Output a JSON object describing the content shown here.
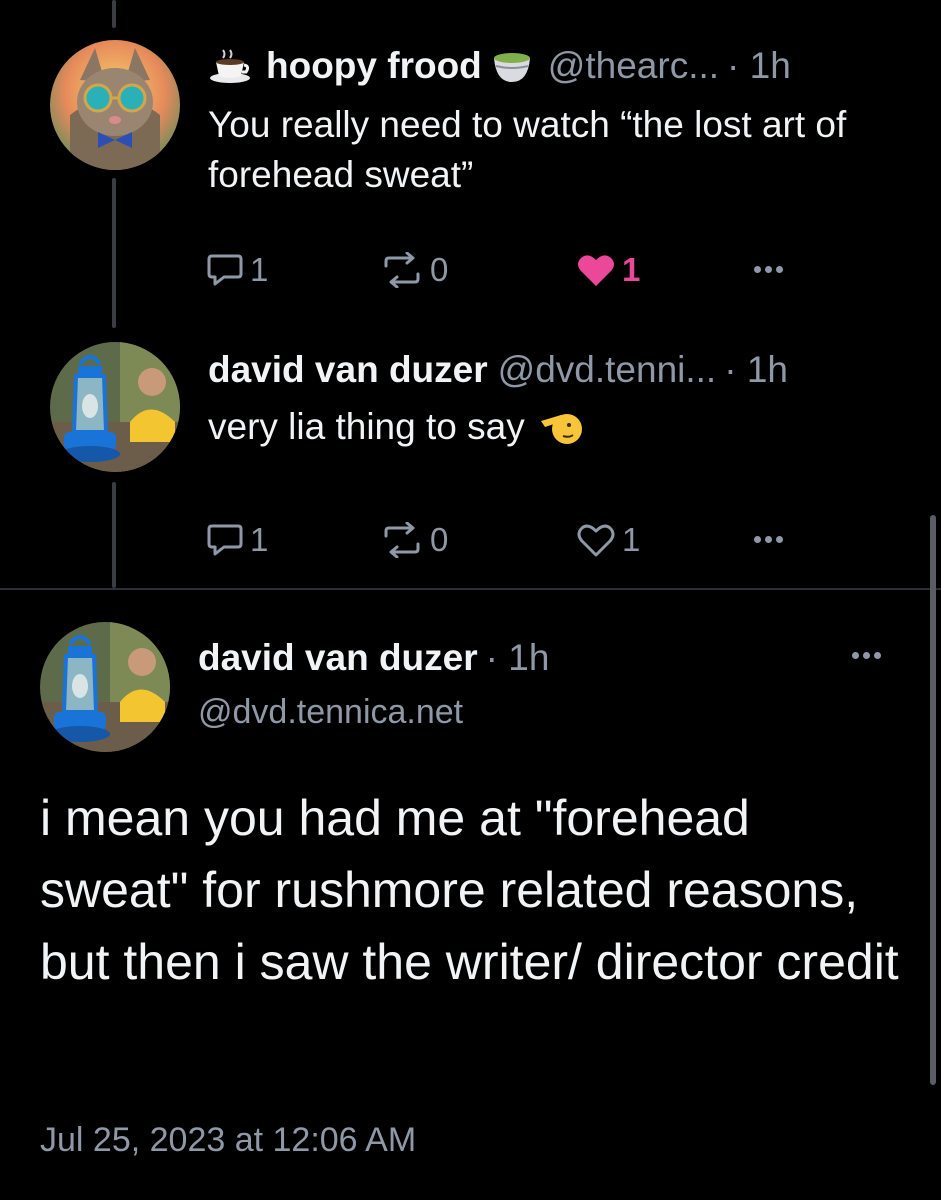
{
  "posts": [
    {
      "author": "hoopy frood",
      "handle": "@thearc...",
      "time": "· 1h",
      "text": "You really need to watch “the lost art of forehead sweat”",
      "replies": "1",
      "reposts": "0",
      "likes": "1",
      "liked": true,
      "avatar_icon": "cat-with-sunglasses-avatar",
      "emoji_before": "coffee-cup-emoji",
      "emoji_after": "tea-bowl-emoji"
    },
    {
      "author": "david van duzer",
      "handle": "@dvd.tenni...",
      "time": "· 1h",
      "text": "very lia thing to say",
      "replies": "1",
      "reposts": "0",
      "likes": "1",
      "liked": false,
      "avatar_icon": "lantern-avatar",
      "emoji_after": "saluting-face-emoji"
    }
  ],
  "main_post": {
    "author": "david van duzer",
    "time": "· 1h",
    "handle": "@dvd.tennica.net",
    "text": "i mean you had me at \"forehead sweat\" for rushmore related reasons, but then i saw the writer/ director credit",
    "date": "Jul 25, 2023 at 12:06 AM",
    "avatar_icon": "lantern-avatar"
  },
  "colors": {
    "background": "#000000",
    "text": "#f1f3f5",
    "muted": "#8f98a6",
    "like": "#ec4899",
    "thread_line": "#3a3d44"
  }
}
